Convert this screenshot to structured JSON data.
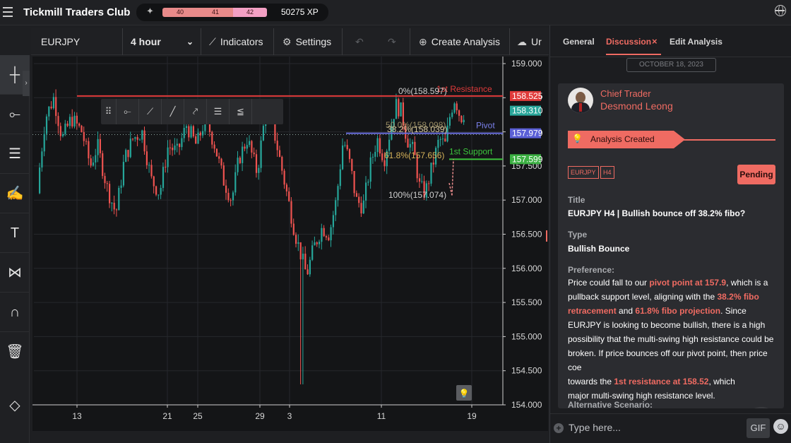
{
  "app": {
    "title": "Tickmill Traders Club",
    "levels": [
      "40",
      "41",
      "42"
    ],
    "xp": "50275 XP"
  },
  "toolbar": {
    "symbol": "EURJPY",
    "interval": "4 hour",
    "indicators": "Indicators",
    "settings": "Settings",
    "create_analysis": "Create Analysis",
    "upload_partial": "Ur"
  },
  "chart_data": {
    "type": "candlestick",
    "symbol": "EURJPY",
    "timeframe": "4 hour",
    "y_ticks": [
      "159.000",
      "158.500",
      "158.000",
      "157.500",
      "157.000",
      "156.500",
      "156.000",
      "155.500",
      "155.000",
      "154.500",
      "154.000"
    ],
    "ylim": [
      154.0,
      159.0
    ],
    "x_ticks": [
      "13",
      "21",
      "25",
      "29",
      "3",
      "11",
      "19"
    ],
    "price_tags": [
      {
        "label": "158.525",
        "value": 158.525,
        "color": "#e03b3b"
      },
      {
        "label": "158.310",
        "value": 158.31,
        "color": "#2aa79b"
      },
      {
        "label": "157.979",
        "value": 157.979,
        "color": "#5a5fd6"
      },
      {
        "label": "157.599",
        "value": 157.599,
        "color": "#3cb043"
      }
    ],
    "horizontal_lines": [
      {
        "name": "1st Resistance",
        "value": 158.525,
        "color": "#e03b3b"
      },
      {
        "name": "Pivot",
        "value": 157.979,
        "color": "#6a6fe0"
      },
      {
        "name": "1st Support",
        "value": 157.599,
        "color": "#3cc43c"
      }
    ],
    "fib_labels": [
      {
        "text": "0%(158.597)",
        "value": 158.597
      },
      {
        "text": "38.2%(158.039)",
        "value": 158.039
      },
      {
        "text": "61.8%(157.656)",
        "value": 157.656
      },
      {
        "text": "100%(157.074)",
        "value": 157.074
      }
    ],
    "fib_overlap_label": "50.0%(158.098)"
  },
  "panel": {
    "tabs": [
      {
        "label": "General"
      },
      {
        "label": "Discussion"
      },
      {
        "label": "Edit Analysis"
      }
    ],
    "tab_close": "×",
    "date": "OCTOBER 18, 2023",
    "author_role": "Chief Trader",
    "author_name": "Desmond Leong",
    "status": "Analysis Created",
    "tags": [
      "EURJPY",
      "H4"
    ],
    "pending": "Pending",
    "title_label": "Title",
    "title_value": "EURJPY H4 | Bullish bounce off 38.2% fibo?",
    "type_label": "Type",
    "type_value": "Bullish Bounce",
    "preference_label": "Preference:",
    "preference": {
      "t1": "Price could fall to our ",
      "h1": "pivot point at 157.9",
      "t2": ", which is a pullback support level, aligning with the ",
      "h2": "38.2% fibo retracement",
      "t3": " and ",
      "h3": "61.8% fibo projection",
      "t4": ". Since EURJPY is looking to become bullish, there is a high possibility that the multi-swing high resistance could be broken. If price bounces off our pivot point, then price co",
      "t4b": "e",
      "t5": "towards the ",
      "h4": "1st resistance at 158.52",
      "t6": ", which",
      "t7": "major multi-swing high resistance level."
    },
    "alt_label": "Alternative Scenario:",
    "composer_placeholder": "Type here...",
    "gif": "GIF"
  }
}
